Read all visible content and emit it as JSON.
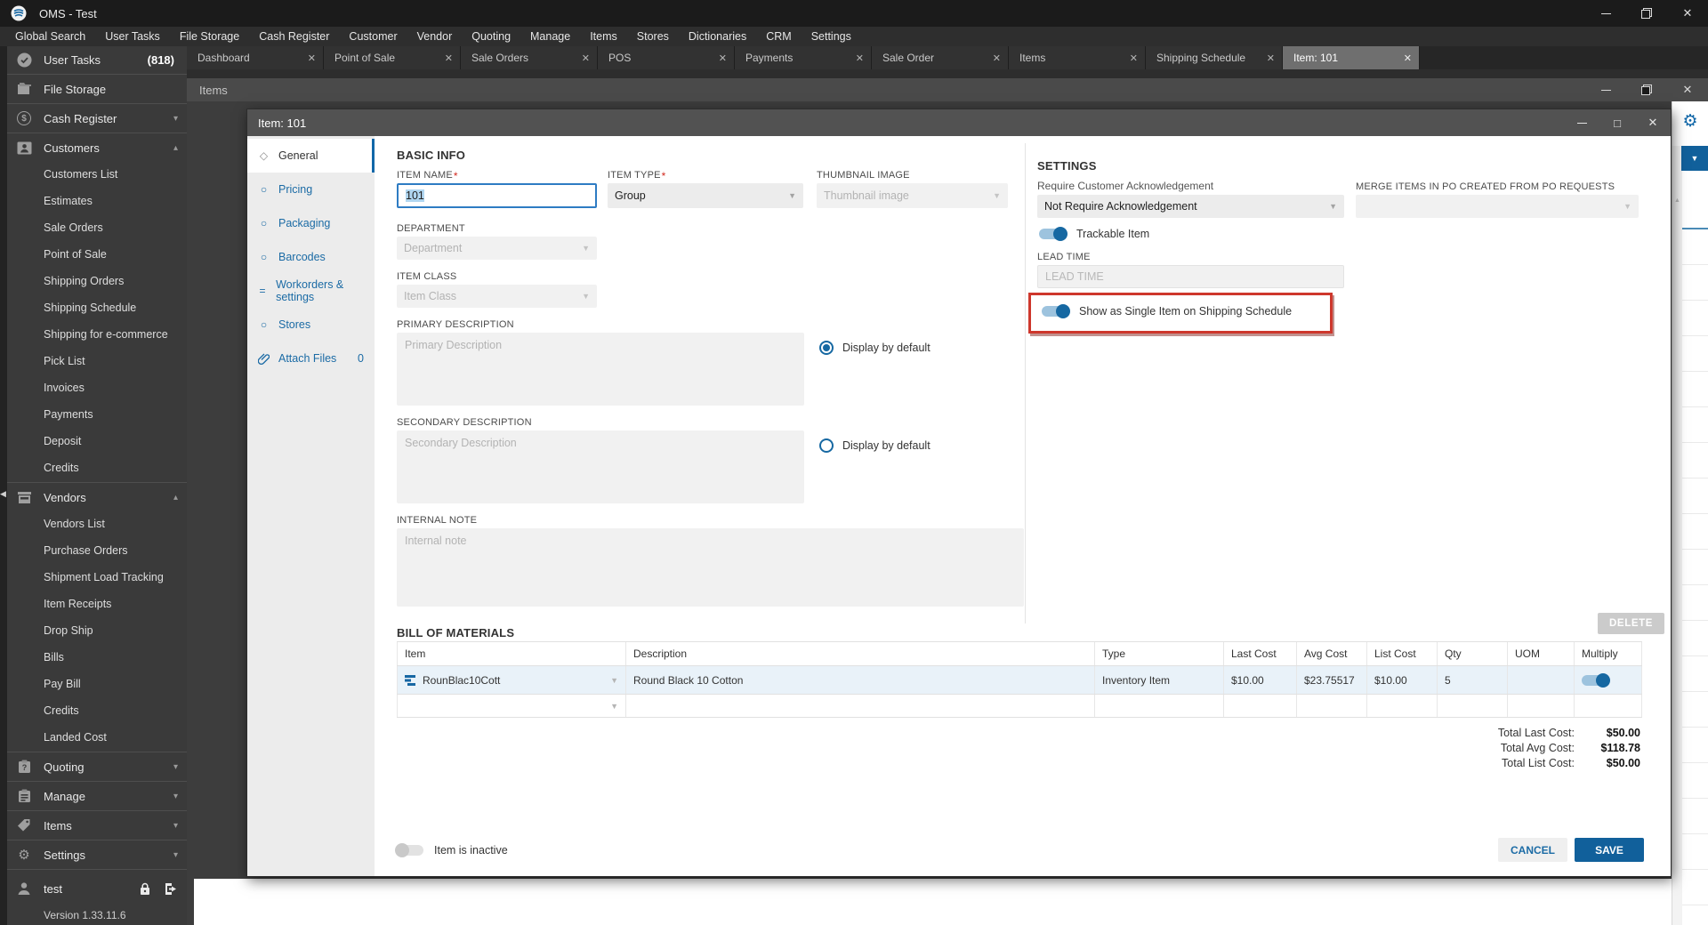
{
  "icons": {
    "close": "✕",
    "maximize": "□",
    "dropdown": "▼",
    "chevron_down": "▾",
    "chevron_up": "▴",
    "gear": "⚙",
    "scroll_up": "▲",
    "back_arrow": "◀",
    "diamond": "◇",
    "circle": "○",
    "equals": "="
  },
  "ui": {
    "required_marker": "*"
  },
  "colors": {
    "accent": "#11609b",
    "toggle_on": "#1668a2",
    "annotation_red": "#ce372c",
    "row_highlight": "#e9f2f9"
  },
  "titlebar": {
    "title": "OMS - Test"
  },
  "menubar": {
    "items": [
      "Global Search",
      "User Tasks",
      "File Storage",
      "Cash Register",
      "Customer",
      "Vendor",
      "Quoting",
      "Manage",
      "Items",
      "Stores",
      "Dictionaries",
      "CRM",
      "Settings"
    ]
  },
  "tabs": [
    {
      "label": "Dashboard"
    },
    {
      "label": "Point of Sale"
    },
    {
      "label": "Sale Orders"
    },
    {
      "label": "POS"
    },
    {
      "label": "Payments"
    },
    {
      "label": "Sale Order"
    },
    {
      "label": "Items"
    },
    {
      "label": "Shipping Schedule"
    },
    {
      "label": "Item: 101",
      "active": true
    }
  ],
  "sidebar": {
    "sections": [
      {
        "label": "User Tasks",
        "badge": "(818)"
      },
      {
        "label": "File Storage"
      },
      {
        "label": "Cash Register"
      },
      {
        "label": "Customers",
        "children": [
          "Customers List",
          "Estimates",
          "Sale Orders",
          "Point of Sale",
          "Shipping Orders",
          "Shipping Schedule",
          "Shipping for e-commerce",
          "Pick List",
          "Invoices",
          "Payments",
          "Deposit",
          "Credits"
        ]
      },
      {
        "label": "Vendors",
        "children": [
          "Vendors List",
          "Purchase Orders",
          "Shipment Load Tracking",
          "Item Receipts",
          "Drop Ship",
          "Bills",
          "Pay Bill",
          "Credits",
          "Landed Cost"
        ]
      },
      {
        "label": "Quoting"
      },
      {
        "label": "Manage"
      },
      {
        "label": "Items"
      },
      {
        "label": "Settings"
      }
    ],
    "user": {
      "name": "test",
      "version": "Version 1.33.11.6"
    }
  },
  "items_window": {
    "title": "Items"
  },
  "dialog": {
    "title": "Item: 101",
    "nav": [
      {
        "label": "General"
      },
      {
        "label": "Pricing"
      },
      {
        "label": "Packaging"
      },
      {
        "label": "Barcodes"
      },
      {
        "label": "Workorders & settings"
      },
      {
        "label": "Stores"
      },
      {
        "label": "Attach Files",
        "count": "0"
      }
    ],
    "basic_info": {
      "heading": "BASIC INFO",
      "item_name": {
        "label": "ITEM NAME",
        "value": "101"
      },
      "item_type": {
        "label": "ITEM TYPE",
        "value": "Group"
      },
      "thumbnail": {
        "label": "THUMBNAIL IMAGE",
        "placeholder": "Thumbnail image"
      },
      "department": {
        "label": "DEPARTMENT",
        "placeholder": "Department"
      },
      "item_class": {
        "label": "ITEM CLASS",
        "placeholder": "Item Class"
      },
      "primary_description": {
        "label": "PRIMARY DESCRIPTION",
        "placeholder": "Primary Description",
        "radio_label": "Display by default"
      },
      "secondary_description": {
        "label": "SECONDARY DESCRIPTION",
        "placeholder": "Secondary Description",
        "radio_label": "Display by default"
      },
      "internal_note": {
        "label": "INTERNAL NOTE",
        "placeholder": "Internal note"
      }
    },
    "settings": {
      "heading": "SETTINGS",
      "require_ack": {
        "label": "Require Customer Acknowledgement",
        "value": "Not Require Acknowledgement"
      },
      "trackable": {
        "label": "Trackable Item"
      },
      "lead_time": {
        "label": "LEAD TIME",
        "placeholder": "LEAD TIME"
      },
      "single_item": {
        "label": "Show as Single Item on Shipping Schedule"
      },
      "merge_items": {
        "label": "MERGE ITEMS IN PO CREATED FROM PO REQUESTS",
        "value": ""
      }
    },
    "bom": {
      "heading": "BILL OF MATERIALS",
      "delete_label": "DELETE",
      "columns": [
        "Item",
        "Description",
        "Type",
        "Last Cost",
        "Avg Cost",
        "List Cost",
        "Qty",
        "UOM",
        "Multiply"
      ],
      "rows": [
        {
          "item": "RounBlac10Cott",
          "description": "Round Black 10 Cotton",
          "type": "Inventory Item",
          "last_cost": "$10.00",
          "avg_cost": "$23.75517",
          "list_cost": "$10.00",
          "qty": "5",
          "uom": ""
        }
      ],
      "totals": [
        {
          "label": "Total Last Cost:",
          "value": "$50.00"
        },
        {
          "label": "Total Avg Cost:",
          "value": "$118.78"
        },
        {
          "label": "Total List Cost:",
          "value": "$50.00"
        }
      ]
    },
    "footer": {
      "inactive_label": "Item is inactive",
      "cancel": "CANCEL",
      "save": "SAVE"
    }
  }
}
